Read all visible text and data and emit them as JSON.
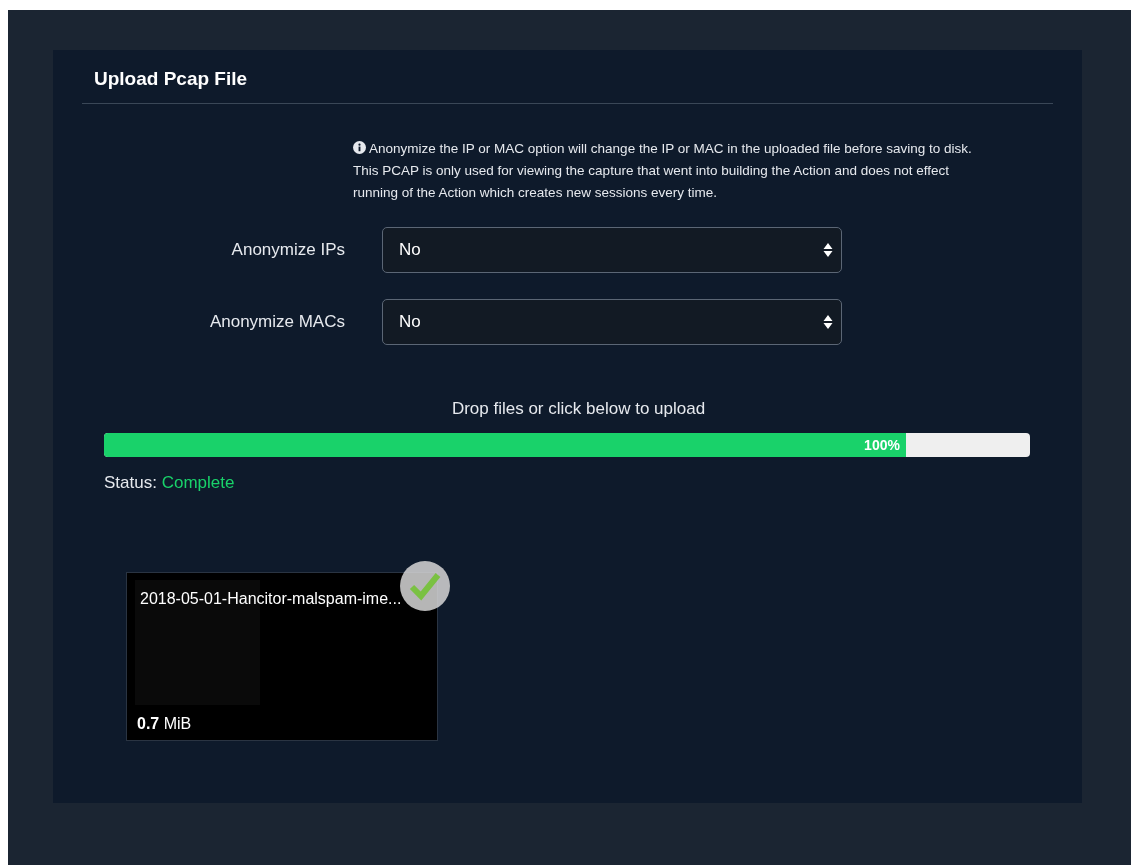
{
  "panel": {
    "title": "Upload Pcap File",
    "info": "Anonymize the IP or MAC option will change the IP or MAC in the uploaded file before saving to disk. This PCAP is only used for viewing the capture that went into building the Action and does not effect running of the Action which creates new sessions every time.",
    "fields": [
      {
        "label": "Anonymize IPs",
        "value": "No"
      },
      {
        "label": "Anonymize MACs",
        "value": "No"
      }
    ],
    "drop_hint": "Drop files or click below to upload",
    "progress": {
      "level": 0.866,
      "reading": "100%"
    },
    "status": {
      "label": "Status:",
      "value": "Complete"
    },
    "files": [
      {
        "name": "2018-05-01-Hancitor-malspam-ime...",
        "size": "0.7",
        "unit": "MiB",
        "done": true
      }
    ]
  }
}
